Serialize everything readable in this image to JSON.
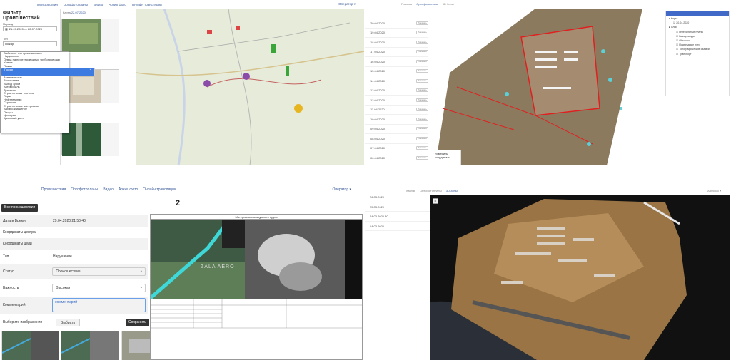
{
  "q1": {
    "nav": [
      "Происшествия",
      "Ортофотопланы",
      "Видео",
      "Архив фото",
      "Онлайн трансляции"
    ],
    "operator": "Оператор ▾",
    "title": "Фильтр Происшествий",
    "map_label": "Карта",
    "map_date": "22.07.2020",
    "period_label": "Период",
    "period_value": "21.07.2020 — 22.07.2020",
    "type_label": "Тип",
    "type_value": "Пожар",
    "types": [
      "Выберите тип происшествия",
      "Нарушение",
      "Отвод на нефтепроводных трубопроводах",
      "Утечка",
      "Пожар",
      "Пожар",
      "Замеченность",
      "Возгорание",
      "Выход зубки",
      "Автомобиль",
      "Трасмини",
      "Строительная техника",
      "Люди",
      "Нефтеванная",
      "Строения",
      "Строительные материалы",
      "Вахано-квашение",
      "Опоры",
      "Цистерна",
      "Крановый узел"
    ],
    "selected_index": 5
  },
  "q2": {
    "tabs": [
      "Главная",
      "Ортофотопланы",
      "3D Зоны"
    ],
    "dates": [
      "20.04.2020",
      "19.04.2020",
      "18.04.2020",
      "17.04.2020",
      "16.04.2020",
      "15.04.2020",
      "14.04.2020",
      "13.04.2020",
      "12.04.2020",
      "11.04.2020",
      "10.04.2020",
      "09.04.2020",
      "08.04.2020",
      "07.04.2020",
      "06.04.2020",
      "05.04.2020"
    ],
    "btn": "Показать",
    "layers": [
      "Карта",
      "20.04.2020",
      "Слои",
      "Генеральные планы",
      "Газопроводы",
      "Объекты",
      "Подъездные пути",
      "Топографические съемки",
      "Транспорт"
    ],
    "coords_label": "Измерить",
    "coords_value": "координаты"
  },
  "q3": {
    "nav": [
      "Происшествия",
      "Ортофотопланы",
      "Видео",
      "Архив фото",
      "Онлайн трансляции"
    ],
    "operator": "Оператор ▾",
    "all_btn": "Все происшествия",
    "num": "2",
    "date_label": "Дата и Время",
    "date_value": "29.04.2020 21:50:40",
    "center_label": "Координаты центра",
    "target_label": "Координаты цели",
    "type_label": "Тип",
    "type_value": "Нарушение",
    "status_label": "Статус",
    "status_value": "Происшествие",
    "importance_label": "Важность",
    "importance_value": "Высокая",
    "comment_label": "Комментарий",
    "comment_value": "комментарий",
    "select_images": "Выберите изображения",
    "pick_btn": "Выбрать",
    "save_btn": "Сохранить",
    "sensor_title": "Материалы с воздушного судна",
    "brand": "ZALA AERO"
  },
  "q4": {
    "tabs": [
      "Главная",
      "Ортофотопланы",
      "3D Зоны"
    ],
    "user": "Admin55 ▾",
    "dates": [
      "26.03.2020",
      "25.03.2020",
      "24.03.2020 30",
      "14.03.2020"
    ],
    "menu_icon": "≡"
  }
}
